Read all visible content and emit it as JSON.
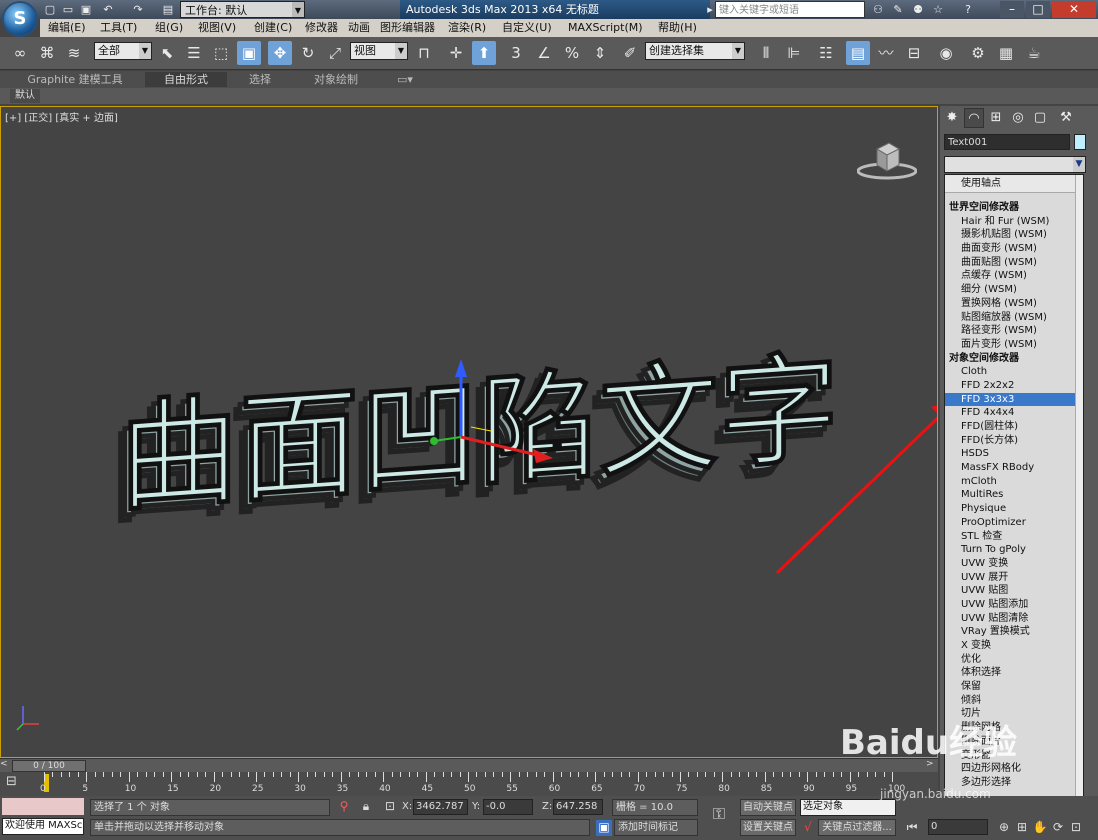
{
  "app": {
    "logo": "S",
    "title": "Autodesk 3ds Max  2013 x64      无标题",
    "workspace": "工作台: 默认",
    "search_placeholder": "键入关键字或短语"
  },
  "menu": [
    "编辑(E)",
    "工具(T)",
    "组(G)",
    "视图(V)",
    "创建(C)",
    "修改器",
    "动画",
    "图形编辑器",
    "渲染(R)",
    "自定义(U)",
    "MAXScript(M)",
    "帮助(H)"
  ],
  "toolbar": {
    "filter": "全部",
    "ref_coord": "视图",
    "named_selection": "创建选择集",
    "snap_3": "3",
    "snap_angle": "∠",
    "snap_pct": "%",
    "spinner_snap": "⇕"
  },
  "ribbon": {
    "tabs": [
      "Graphite 建模工具",
      "自由形式",
      "选择",
      "对象绘制"
    ],
    "active_tab": "自由形式",
    "sub": "默认"
  },
  "viewport": {
    "label": "[+] [正交] [真实 + 边面]",
    "text_object": "曲面凹陷文字"
  },
  "command_panel": {
    "object_name": "Text001",
    "object_color": "#bfeeff",
    "list": [
      {
        "text": "使用轴点",
        "kind": "pivot"
      },
      {
        "text": "世界空间修改器",
        "kind": "header"
      },
      {
        "text": "Hair 和 Fur (WSM)",
        "kind": "item"
      },
      {
        "text": "摄影机贴图 (WSM)",
        "kind": "item"
      },
      {
        "text": "曲面变形 (WSM)",
        "kind": "item"
      },
      {
        "text": "曲面贴图 (WSM)",
        "kind": "item"
      },
      {
        "text": "点缓存 (WSM)",
        "kind": "item"
      },
      {
        "text": "细分 (WSM)",
        "kind": "item"
      },
      {
        "text": "置换网格 (WSM)",
        "kind": "item"
      },
      {
        "text": "贴图缩放器 (WSM)",
        "kind": "item"
      },
      {
        "text": "路径变形 (WSM)",
        "kind": "item"
      },
      {
        "text": "面片变形 (WSM)",
        "kind": "item"
      },
      {
        "text": "对象空间修改器",
        "kind": "header"
      },
      {
        "text": "Cloth",
        "kind": "item"
      },
      {
        "text": "FFD 2x2x2",
        "kind": "item"
      },
      {
        "text": "FFD 3x3x3",
        "kind": "selected"
      },
      {
        "text": "FFD 4x4x4",
        "kind": "item"
      },
      {
        "text": "FFD(圆柱体)",
        "kind": "item"
      },
      {
        "text": "FFD(长方体)",
        "kind": "item"
      },
      {
        "text": "HSDS",
        "kind": "item"
      },
      {
        "text": "MassFX RBody",
        "kind": "item"
      },
      {
        "text": "mCloth",
        "kind": "item"
      },
      {
        "text": "MultiRes",
        "kind": "item"
      },
      {
        "text": "Physique",
        "kind": "item"
      },
      {
        "text": "ProOptimizer",
        "kind": "item"
      },
      {
        "text": "STL 检查",
        "kind": "item"
      },
      {
        "text": "Turn To gPoly",
        "kind": "item"
      },
      {
        "text": "UVW 变换",
        "kind": "item"
      },
      {
        "text": "UVW 展开",
        "kind": "item"
      },
      {
        "text": "UVW 贴图",
        "kind": "item"
      },
      {
        "text": "UVW 贴图添加",
        "kind": "item"
      },
      {
        "text": "UVW 贴图清除",
        "kind": "item"
      },
      {
        "text": "VRay 置换模式",
        "kind": "item"
      },
      {
        "text": "X 变换",
        "kind": "item"
      },
      {
        "text": "优化",
        "kind": "item"
      },
      {
        "text": "体积选择",
        "kind": "item"
      },
      {
        "text": "保留",
        "kind": "item"
      },
      {
        "text": "倾斜",
        "kind": "item"
      },
      {
        "text": "切片",
        "kind": "item"
      },
      {
        "text": "删除网格",
        "kind": "item"
      },
      {
        "text": "删除面片",
        "kind": "item"
      },
      {
        "text": "变形器",
        "kind": "item"
      },
      {
        "text": "四边形网格化",
        "kind": "item"
      },
      {
        "text": "多边形选择",
        "kind": "item"
      }
    ]
  },
  "timeline": {
    "frame_display": "0 / 100",
    "ticks": [
      "0",
      "5",
      "10",
      "15",
      "20",
      "25",
      "30",
      "35",
      "40",
      "45",
      "50",
      "55",
      "60",
      "65",
      "70",
      "75",
      "80",
      "85",
      "90",
      "95",
      "100"
    ]
  },
  "status": {
    "welcome": "欢迎使用 MAXSc",
    "selection_info": "选择了 1 个 对象",
    "prompt": "单击并拖动以选择并移动对象",
    "x_label": "X:",
    "x_value": "3462.787",
    "y_label": "Y:",
    "y_value": "-0.0",
    "z_label": "Z:",
    "z_value": "647.258",
    "grid": "栅格 = 10.0",
    "add_time_tag": "添加时间标记",
    "auto_key": "自动关键点",
    "set_key": "设置关键点",
    "selected_object": "选定对象",
    "key_filters": "关键点过滤器...",
    "frame": "0"
  },
  "watermark": {
    "text": "Baidu经验",
    "sub": "jingyan.baidu.com"
  }
}
